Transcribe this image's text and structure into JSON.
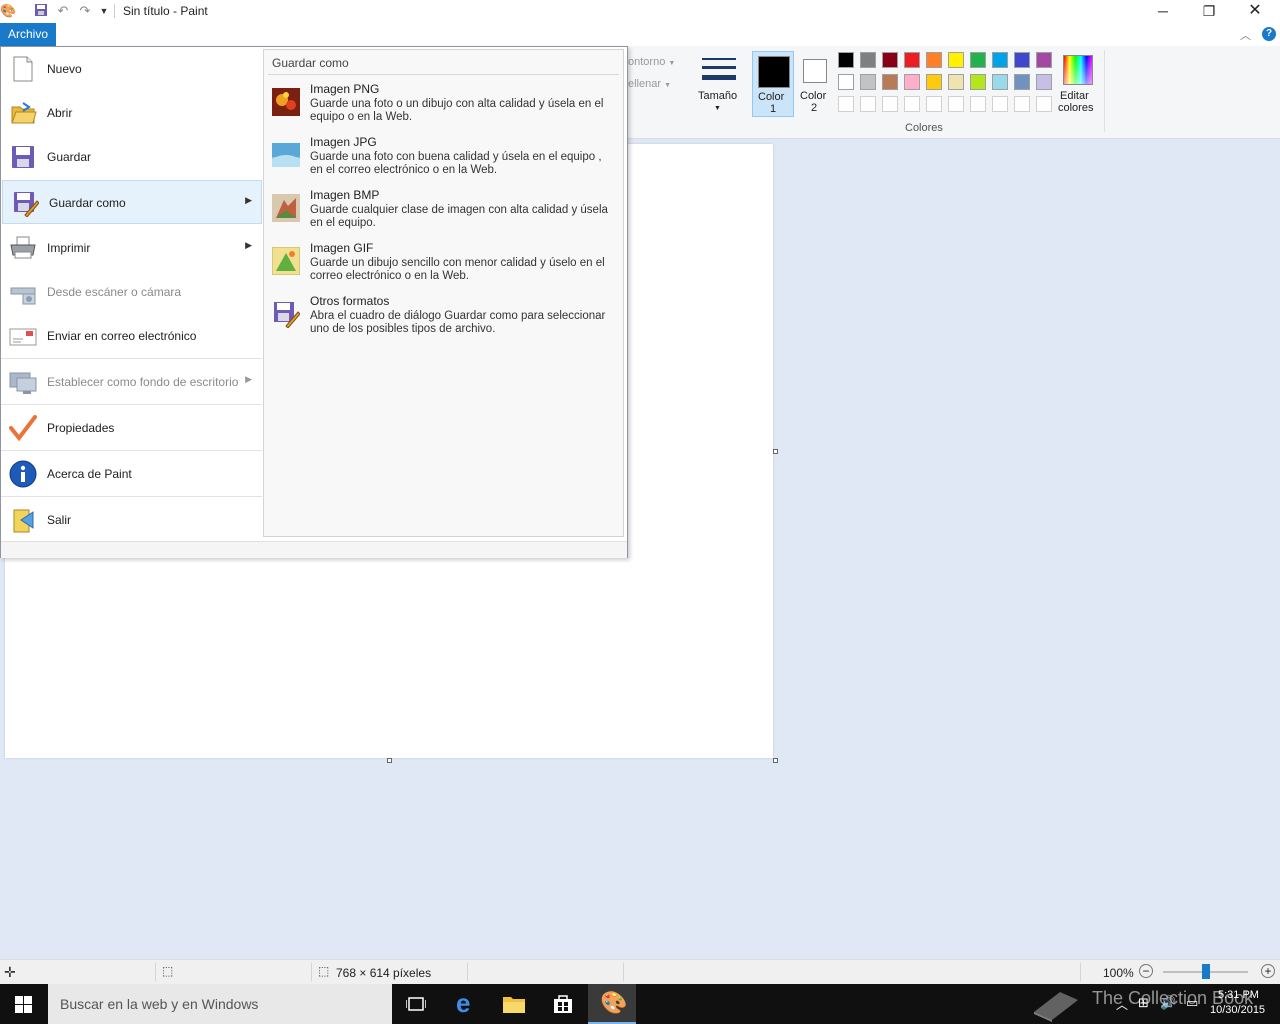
{
  "window": {
    "title": "Sin título - Paint",
    "minimize": "─",
    "restore": "❐",
    "close": "✕"
  },
  "ribbon": {
    "file_tab": "Archivo",
    "contorno": "ontorno",
    "rellenar": "ellenar",
    "size_label": "Tamaño",
    "color1_label": "Color",
    "color1_num": "1",
    "color2_label": "Color",
    "color2_num": "2",
    "edit_colors_line1": "Editar",
    "edit_colors_line2": "colores",
    "colors_group": "Colores",
    "palette_row1": [
      "#000000",
      "#7f7f7f",
      "#880015",
      "#ed1c24",
      "#ff7f27",
      "#fff200",
      "#22b14c",
      "#00a2e8",
      "#3f48cc",
      "#a349a4"
    ],
    "palette_row2": [
      "#ffffff",
      "#c3c3c3",
      "#b97a57",
      "#ffaec9",
      "#ffc90e",
      "#efe4b0",
      "#b5e61d",
      "#99d9ea",
      "#7092be",
      "#c8bfe7"
    ]
  },
  "menu": {
    "items": [
      {
        "label": "Nuevo",
        "icon": "new-file-icon"
      },
      {
        "label": "Abrir",
        "icon": "open-folder-icon"
      },
      {
        "label": "Guardar",
        "icon": "save-icon"
      },
      {
        "label": "Guardar como",
        "icon": "save-as-icon"
      },
      {
        "label": "Imprimir",
        "icon": "printer-icon"
      },
      {
        "label": "Desde escáner o cámara",
        "icon": "scanner-icon"
      },
      {
        "label": "Enviar en correo electrónico",
        "icon": "email-icon"
      },
      {
        "label": "Establecer como fondo de escritorio",
        "icon": "desktop-background-icon"
      },
      {
        "label": "Propiedades",
        "icon": "checkmark-icon"
      },
      {
        "label": "Acerca de Paint",
        "icon": "info-icon"
      },
      {
        "label": "Salir",
        "icon": "exit-icon"
      }
    ]
  },
  "submenu": {
    "header": "Guardar como",
    "items": [
      {
        "title": "Imagen PNG",
        "desc": "Guarde una foto o un dibujo con alta calidad y úsela en el equipo o en la Web."
      },
      {
        "title": "Imagen JPG",
        "desc": "Guarde una foto con buena calidad y úsela en el equipo , en el correo electrónico o en la Web."
      },
      {
        "title": "Imagen BMP",
        "desc": "Guarde cualquier clase de imagen con alta calidad y úsela en el equipo."
      },
      {
        "title": "Imagen GIF",
        "desc": "Guarde un dibujo sencillo con menor calidad y úselo en el correo electrónico o en la Web."
      },
      {
        "title": "Otros formatos",
        "desc": "Abra el cuadro de diálogo Guardar como para seleccionar uno de los posibles tipos de archivo."
      }
    ]
  },
  "status": {
    "dimensions": "768 × 614 píxeles",
    "zoom": "100%"
  },
  "taskbar": {
    "search_placeholder": "Buscar en la web y en Windows",
    "time": "5:31 PM",
    "date": "10/30/2015",
    "watermark": "The Collection Book"
  }
}
